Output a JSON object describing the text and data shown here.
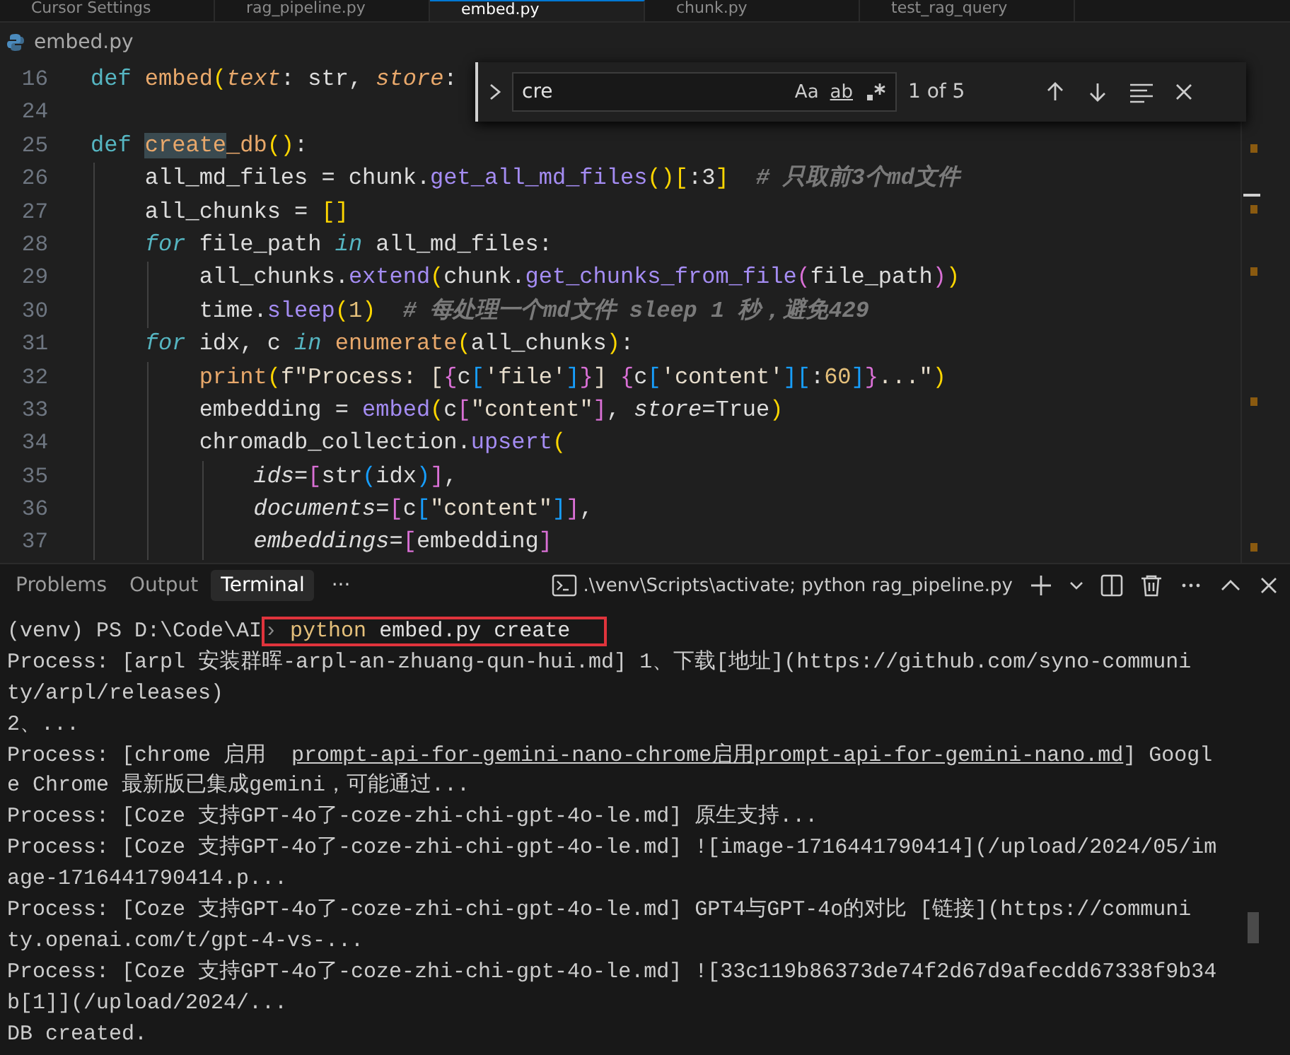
{
  "editor_tabs": [
    {
      "label": "Cursor Settings",
      "selected": false
    },
    {
      "label": "rag_pipeline.py",
      "selected": false
    },
    {
      "label": "embed.py",
      "selected": true
    },
    {
      "label": "chunk.py",
      "selected": false
    },
    {
      "label": "test_rag_query",
      "selected": false
    }
  ],
  "breadcrumb": {
    "file": "embed.py"
  },
  "code_lines": [
    {
      "number": "16",
      "tokens": [
        {
          "kind": "kw",
          "text": "def "
        },
        {
          "kind": "fn",
          "text": "embed"
        },
        {
          "kind": "b1",
          "text": "("
        },
        {
          "kind": "param",
          "text": "text"
        },
        {
          "kind": "plain",
          "text": ": str, "
        },
        {
          "kind": "param",
          "text": "store"
        },
        {
          "kind": "plain",
          "text": ": "
        }
      ]
    },
    {
      "number": "24"
    },
    {
      "number": "25",
      "tokens": [
        {
          "kind": "kw",
          "text": "def "
        },
        {
          "kind": "fn",
          "text": "create",
          "match": true
        },
        {
          "kind": "fn",
          "text": "_db"
        },
        {
          "kind": "b1",
          "text": "()"
        },
        {
          "kind": "plain",
          "text": ":"
        }
      ]
    },
    {
      "number": "26",
      "tokens": [
        {
          "kind": "plain",
          "text": "    all_md_files = chunk."
        },
        {
          "kind": "method",
          "text": "get_all_md_files"
        },
        {
          "kind": "b1",
          "text": "()"
        },
        {
          "kind": "b1",
          "text": "["
        },
        {
          "kind": "plain",
          "text": ":3"
        },
        {
          "kind": "b1",
          "text": "]"
        },
        {
          "kind": "cmt",
          "text": "  # 只取前3个md文件"
        }
      ]
    },
    {
      "number": "27",
      "tokens": [
        {
          "kind": "plain",
          "text": "    all_chunks = "
        },
        {
          "kind": "b1",
          "text": "[]"
        }
      ]
    },
    {
      "number": "28",
      "tokens": [
        {
          "kind": "ctl",
          "text": "    for"
        },
        {
          "kind": "plain",
          "text": " file_path "
        },
        {
          "kind": "ctl",
          "text": "in"
        },
        {
          "kind": "plain",
          "text": " all_md_files:"
        }
      ]
    },
    {
      "number": "29",
      "tokens": [
        {
          "kind": "plain",
          "text": "        all_chunks."
        },
        {
          "kind": "method",
          "text": "extend"
        },
        {
          "kind": "b1",
          "text": "("
        },
        {
          "kind": "plain",
          "text": "chunk."
        },
        {
          "kind": "method",
          "text": "get_chunks_from_file"
        },
        {
          "kind": "b2",
          "text": "("
        },
        {
          "kind": "plain",
          "text": "file_path"
        },
        {
          "kind": "b2",
          "text": ")"
        },
        {
          "kind": "b1",
          "text": ")"
        }
      ]
    },
    {
      "number": "30",
      "tokens": [
        {
          "kind": "plain",
          "text": "        time."
        },
        {
          "kind": "method",
          "text": "sleep"
        },
        {
          "kind": "b1",
          "text": "("
        },
        {
          "kind": "num",
          "text": "1"
        },
        {
          "kind": "b1",
          "text": ")"
        },
        {
          "kind": "cmt",
          "text": "  # 每处理一个md文件 sleep 1 秒，避免429"
        }
      ]
    },
    {
      "number": "31",
      "tokens": [
        {
          "kind": "ctl",
          "text": "    for"
        },
        {
          "kind": "plain",
          "text": " idx, c "
        },
        {
          "kind": "ctl",
          "text": "in"
        },
        {
          "kind": "fn",
          "text": " enumerate"
        },
        {
          "kind": "b1",
          "text": "("
        },
        {
          "kind": "plain",
          "text": "all_chunks"
        },
        {
          "kind": "b1",
          "text": ")"
        },
        {
          "kind": "plain",
          "text": ":"
        }
      ]
    },
    {
      "number": "32",
      "tokens": [
        {
          "kind": "fn",
          "text": "        print"
        },
        {
          "kind": "b1",
          "text": "("
        },
        {
          "kind": "str",
          "text": "f\"Process: ["
        },
        {
          "kind": "b2",
          "text": "{"
        },
        {
          "kind": "plain",
          "text": "c"
        },
        {
          "kind": "b3",
          "text": "["
        },
        {
          "kind": "str",
          "text": "'file'"
        },
        {
          "kind": "b3",
          "text": "]"
        },
        {
          "kind": "b2",
          "text": "}"
        },
        {
          "kind": "str",
          "text": "] "
        },
        {
          "kind": "b2",
          "text": "{"
        },
        {
          "kind": "plain",
          "text": "c"
        },
        {
          "kind": "b3",
          "text": "["
        },
        {
          "kind": "str",
          "text": "'content'"
        },
        {
          "kind": "b3",
          "text": "]["
        },
        {
          "kind": "plain",
          "text": ":"
        },
        {
          "kind": "num",
          "text": "60"
        },
        {
          "kind": "b3",
          "text": "]"
        },
        {
          "kind": "b2",
          "text": "}"
        },
        {
          "kind": "str",
          "text": "...\""
        },
        {
          "kind": "b1",
          "text": ")"
        }
      ]
    },
    {
      "number": "33",
      "tokens": [
        {
          "kind": "plain",
          "text": "        embedding = "
        },
        {
          "kind": "method",
          "text": "embed"
        },
        {
          "kind": "b1",
          "text": "("
        },
        {
          "kind": "plain",
          "text": "c"
        },
        {
          "kind": "b2",
          "text": "["
        },
        {
          "kind": "str",
          "text": "\"content\""
        },
        {
          "kind": "b2",
          "text": "]"
        },
        {
          "kind": "plain",
          "text": ", "
        },
        {
          "kind": "kwarg",
          "text": "store"
        },
        {
          "kind": "plain",
          "text": "=True"
        },
        {
          "kind": "b1",
          "text": ")"
        }
      ]
    },
    {
      "number": "34",
      "tokens": [
        {
          "kind": "plain",
          "text": "        chromadb_collection."
        },
        {
          "kind": "method",
          "text": "upsert"
        },
        {
          "kind": "b1",
          "text": "("
        }
      ]
    },
    {
      "number": "35",
      "tokens": [
        {
          "kind": "kwarg",
          "text": "            ids"
        },
        {
          "kind": "plain",
          "text": "="
        },
        {
          "kind": "b2",
          "text": "["
        },
        {
          "kind": "plain",
          "text": "str"
        },
        {
          "kind": "b3",
          "text": "("
        },
        {
          "kind": "plain",
          "text": "idx"
        },
        {
          "kind": "b3",
          "text": ")"
        },
        {
          "kind": "b2",
          "text": "]"
        },
        {
          "kind": "plain",
          "text": ","
        }
      ]
    },
    {
      "number": "36",
      "tokens": [
        {
          "kind": "kwarg",
          "text": "            documents"
        },
        {
          "kind": "plain",
          "text": "="
        },
        {
          "kind": "b2",
          "text": "["
        },
        {
          "kind": "plain",
          "text": "c"
        },
        {
          "kind": "b3",
          "text": "["
        },
        {
          "kind": "str",
          "text": "\"content\""
        },
        {
          "kind": "b3",
          "text": "]"
        },
        {
          "kind": "b2",
          "text": "]"
        },
        {
          "kind": "plain",
          "text": ","
        }
      ]
    },
    {
      "number": "37",
      "tokens": [
        {
          "kind": "kwarg",
          "text": "            embeddings"
        },
        {
          "kind": "plain",
          "text": "="
        },
        {
          "kind": "b2",
          "text": "["
        },
        {
          "kind": "plain",
          "text": "embedding"
        },
        {
          "kind": "b2",
          "text": "]"
        }
      ]
    }
  ],
  "find_widget": {
    "query": "cre",
    "match_count": "1 of 5",
    "match_case_label": "Aa",
    "whole_word_label": "ab"
  },
  "panel_tabs": [
    {
      "label": "Problems",
      "selected": false
    },
    {
      "label": "Output",
      "selected": false
    },
    {
      "label": "Terminal",
      "selected": true
    }
  ],
  "panel_more": "···",
  "terminal_title": ".\\venv\\Scripts\\activate; python rag_pipeline.py",
  "terminal_lines": [
    {
      "boxed": true,
      "segments": [
        {
          "kind": "prompt",
          "text": "(venv) PS D:\\Code\\AI"
        },
        {
          "kind": "marker",
          "text": "›"
        },
        {
          "kind": "command",
          "text": " python"
        },
        {
          "kind": "args",
          "text": " embed.py create"
        }
      ]
    },
    {
      "segments": [
        {
          "kind": "plain",
          "text": "Process: [arpl 安装群晖-arpl-an-zhuang-qun-hui.md] 1、下载[地址](https://github.com/syno-communi"
        }
      ]
    },
    {
      "segments": [
        {
          "kind": "plain",
          "text": "ty/arpl/releases)"
        }
      ]
    },
    {
      "segments": [
        {
          "kind": "plain",
          "text": "2、..."
        }
      ]
    },
    {
      "segments": [
        {
          "kind": "plain",
          "text": "Process: [chrome 启用  "
        },
        {
          "kind": "link",
          "text": "prompt-api-for-gemini-nano-chrome启用prompt-api-for-gemini-nano.md"
        },
        {
          "kind": "plain",
          "text": "] Googl"
        }
      ]
    },
    {
      "segments": [
        {
          "kind": "plain",
          "text": "e Chrome 最新版已集成gemini，可能通过..."
        }
      ]
    },
    {
      "segments": [
        {
          "kind": "plain",
          "text": "Process: [Coze 支持GPT-4o了-coze-zhi-chi-gpt-4o-le.md] 原生支持..."
        }
      ]
    },
    {
      "segments": [
        {
          "kind": "plain",
          "text": "Process: [Coze 支持GPT-4o了-coze-zhi-chi-gpt-4o-le.md] ![image-1716441790414](/upload/2024/05/im"
        }
      ]
    },
    {
      "segments": [
        {
          "kind": "plain",
          "text": "age-1716441790414.p..."
        }
      ]
    },
    {
      "segments": [
        {
          "kind": "plain",
          "text": "Process: [Coze 支持GPT-4o了-coze-zhi-chi-gpt-4o-le.md] GPT4与GPT-4o的对比 [链接](https://communi"
        }
      ]
    },
    {
      "segments": [
        {
          "kind": "plain",
          "text": "ty.openai.com/t/gpt-4-vs-..."
        }
      ]
    },
    {
      "segments": [
        {
          "kind": "plain",
          "text": "Process: [Coze 支持GPT-4o了-coze-zhi-chi-gpt-4o-le.md] ![33c119b86373de74f2d67d9afecdd67338f9b34"
        }
      ]
    },
    {
      "segments": [
        {
          "kind": "plain",
          "text": "b[1]](/upload/2024/..."
        }
      ]
    },
    {
      "segments": [
        {
          "kind": "plain",
          "text": "DB created."
        }
      ]
    }
  ]
}
